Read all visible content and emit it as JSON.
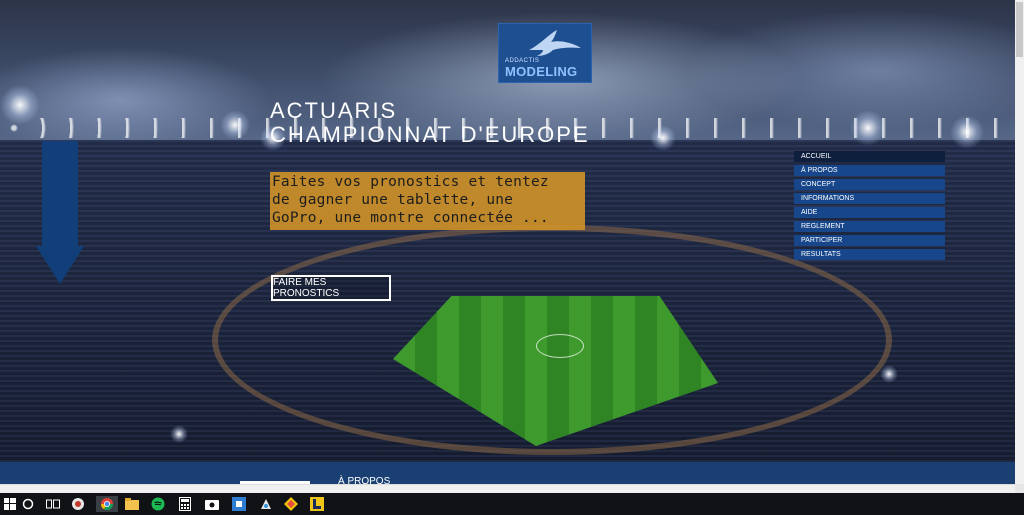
{
  "logo": {
    "small_text": "ADDACTIS",
    "brand_text": "MODELING"
  },
  "hero": {
    "title_line1": "ACTUARIS",
    "title_line2": "CHAMPIONNAT D'EUROPE",
    "promo_lines": [
      "Faites vos pronostics et tentez",
      "de gagner une tablette, une",
      "GoPro, une montre connectée ..."
    ],
    "cta_label": "FAIRE MES PRONOSTICS"
  },
  "menu": {
    "items": [
      {
        "label": "ACCUEIL"
      },
      {
        "label": "À PROPOS"
      },
      {
        "label": "CONCEPT"
      },
      {
        "label": "INFORMATIONS"
      },
      {
        "label": "AIDE"
      },
      {
        "label": "REGLEMENT"
      },
      {
        "label": "PARTICIPER"
      },
      {
        "label": "RESULTATS"
      }
    ],
    "active_index": 0
  },
  "footer": {
    "section_label": "À PROPOS"
  },
  "taskbar": {
    "icons": [
      "windows-start-icon",
      "search-circle-icon",
      "task-view-icon",
      "app-icon",
      "chrome-icon",
      "file-explorer-icon",
      "spotify-icon",
      "calculator-icon",
      "camera-icon",
      "app-square-icon",
      "paint-icon",
      "pinned-app-icon",
      "pinned-app-icon-2"
    ]
  },
  "colors": {
    "menu_bg": "#17478a",
    "menu_active_bg": "#0d1f3c",
    "promo_bg": "#d09228",
    "logo_bg": "#1e4f91",
    "arrow": "#123f7a",
    "footer_band": "#1a3f73"
  }
}
